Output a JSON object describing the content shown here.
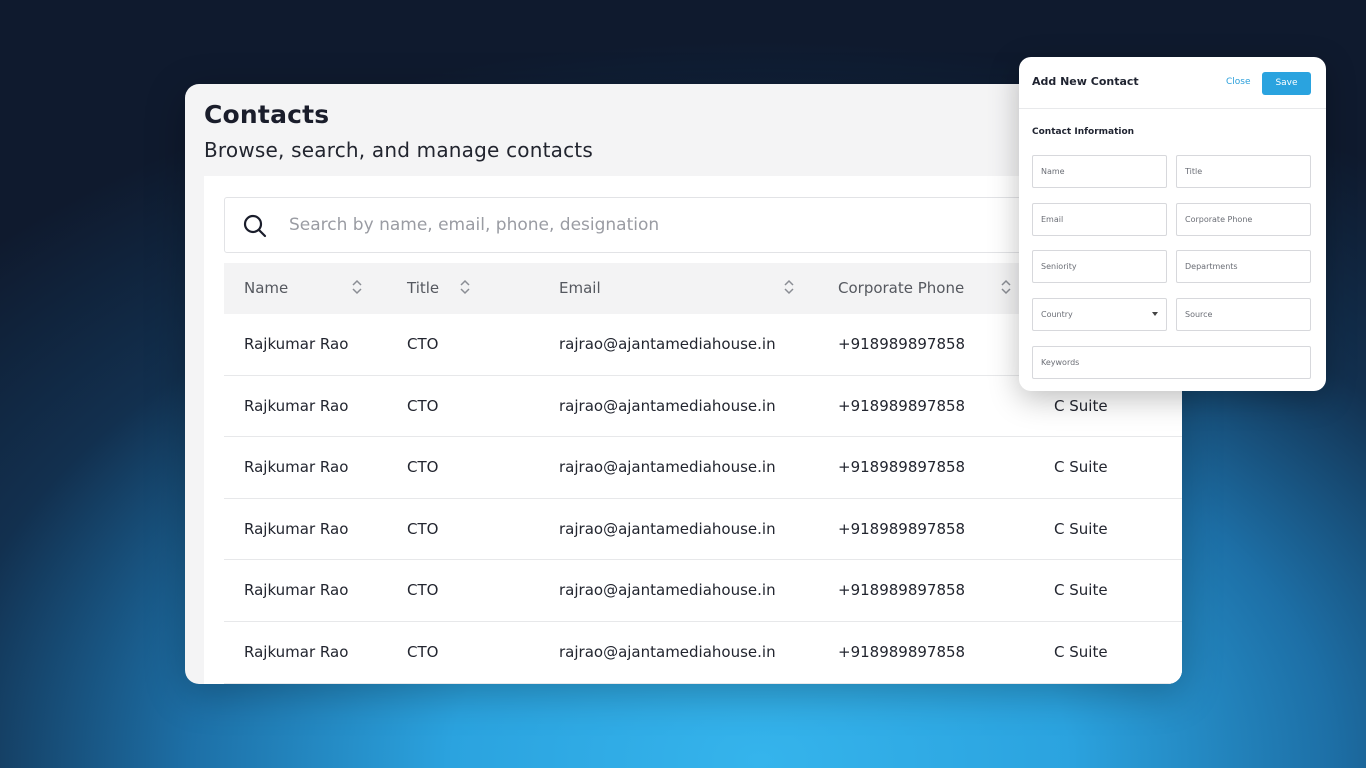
{
  "page": {
    "title": "Contacts",
    "subtitle": "Browse, search, and manage contacts"
  },
  "search": {
    "placeholder": "Search by name, email, phone, designation",
    "icon": "search-icon"
  },
  "table": {
    "columns": [
      "Name",
      "Title",
      "Email",
      "Corporate Phone"
    ],
    "rows": [
      {
        "name": "Rajkumar Rao",
        "title": "CTO",
        "email": "rajrao@ajantamediahouse.in",
        "phone": "+918989897858",
        "seniority": ""
      },
      {
        "name": "Rajkumar Rao",
        "title": "CTO",
        "email": "rajrao@ajantamediahouse.in",
        "phone": "+918989897858",
        "seniority": "C Suite"
      },
      {
        "name": "Rajkumar Rao",
        "title": "CTO",
        "email": "rajrao@ajantamediahouse.in",
        "phone": "+918989897858",
        "seniority": "C Suite"
      },
      {
        "name": "Rajkumar Rao",
        "title": "CTO",
        "email": "rajrao@ajantamediahouse.in",
        "phone": "+918989897858",
        "seniority": "C Suite"
      },
      {
        "name": "Rajkumar Rao",
        "title": "CTO",
        "email": "rajrao@ajantamediahouse.in",
        "phone": "+918989897858",
        "seniority": "C Suite"
      },
      {
        "name": "Rajkumar Rao",
        "title": "CTO",
        "email": "rajrao@ajantamediahouse.in",
        "phone": "+918989897858",
        "seniority": "C Suite"
      }
    ]
  },
  "modal": {
    "title": "Add New Contact",
    "close_label": "Close",
    "save_label": "Save",
    "section_title": "Contact Information",
    "fields": {
      "name": "Name",
      "title": "Title",
      "email": "Email",
      "corporate_phone": "Corporate Phone",
      "seniority": "Seniority",
      "departments": "Departments",
      "country": "Country",
      "source": "Source",
      "keywords": "Keywords"
    }
  },
  "colors": {
    "accent": "#2aa3df",
    "background_glow": "#35b4ec",
    "background_dark": "#0f1a2e"
  }
}
